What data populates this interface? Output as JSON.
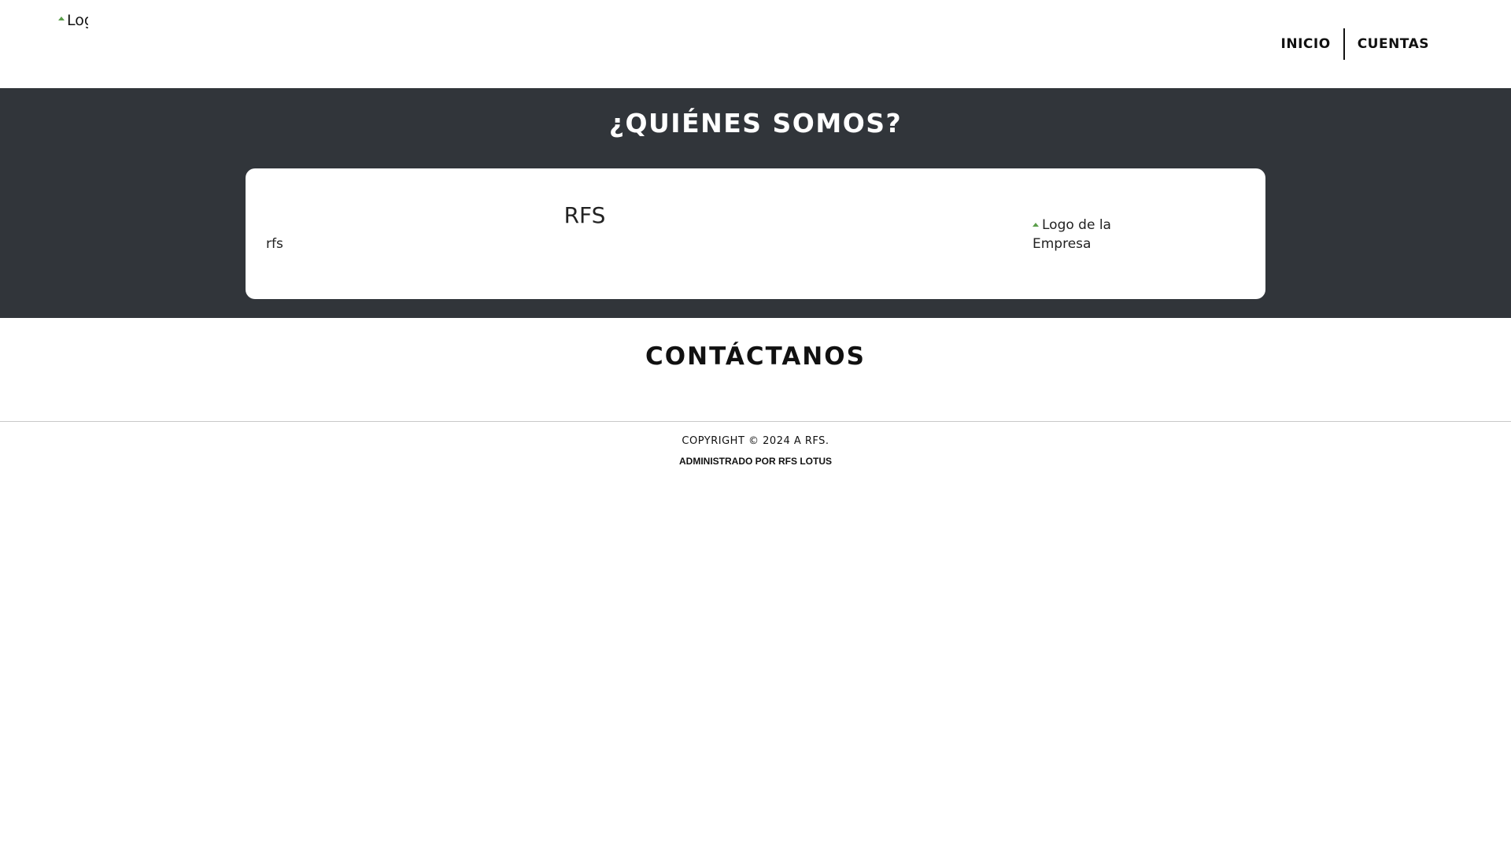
{
  "header": {
    "logo_alt": "Logo",
    "nav": [
      {
        "label": "INICIO"
      },
      {
        "label": "CUENTAS"
      }
    ]
  },
  "about": {
    "title": "¿QUIÉNES SOMOS?",
    "company_name": "RFS",
    "company_description": "rfs",
    "company_logo_alt": "Logo de la Empresa"
  },
  "contact": {
    "title": "CONTÁCTANOS"
  },
  "footer": {
    "copyright": "COPYRIGHT © 2024 A RFS.",
    "admin": "ADMINISTRADO POR RFS LOTUS"
  },
  "colors": {
    "band_background": "#31353a",
    "card_background": "#ffffff",
    "text": "#111111"
  }
}
